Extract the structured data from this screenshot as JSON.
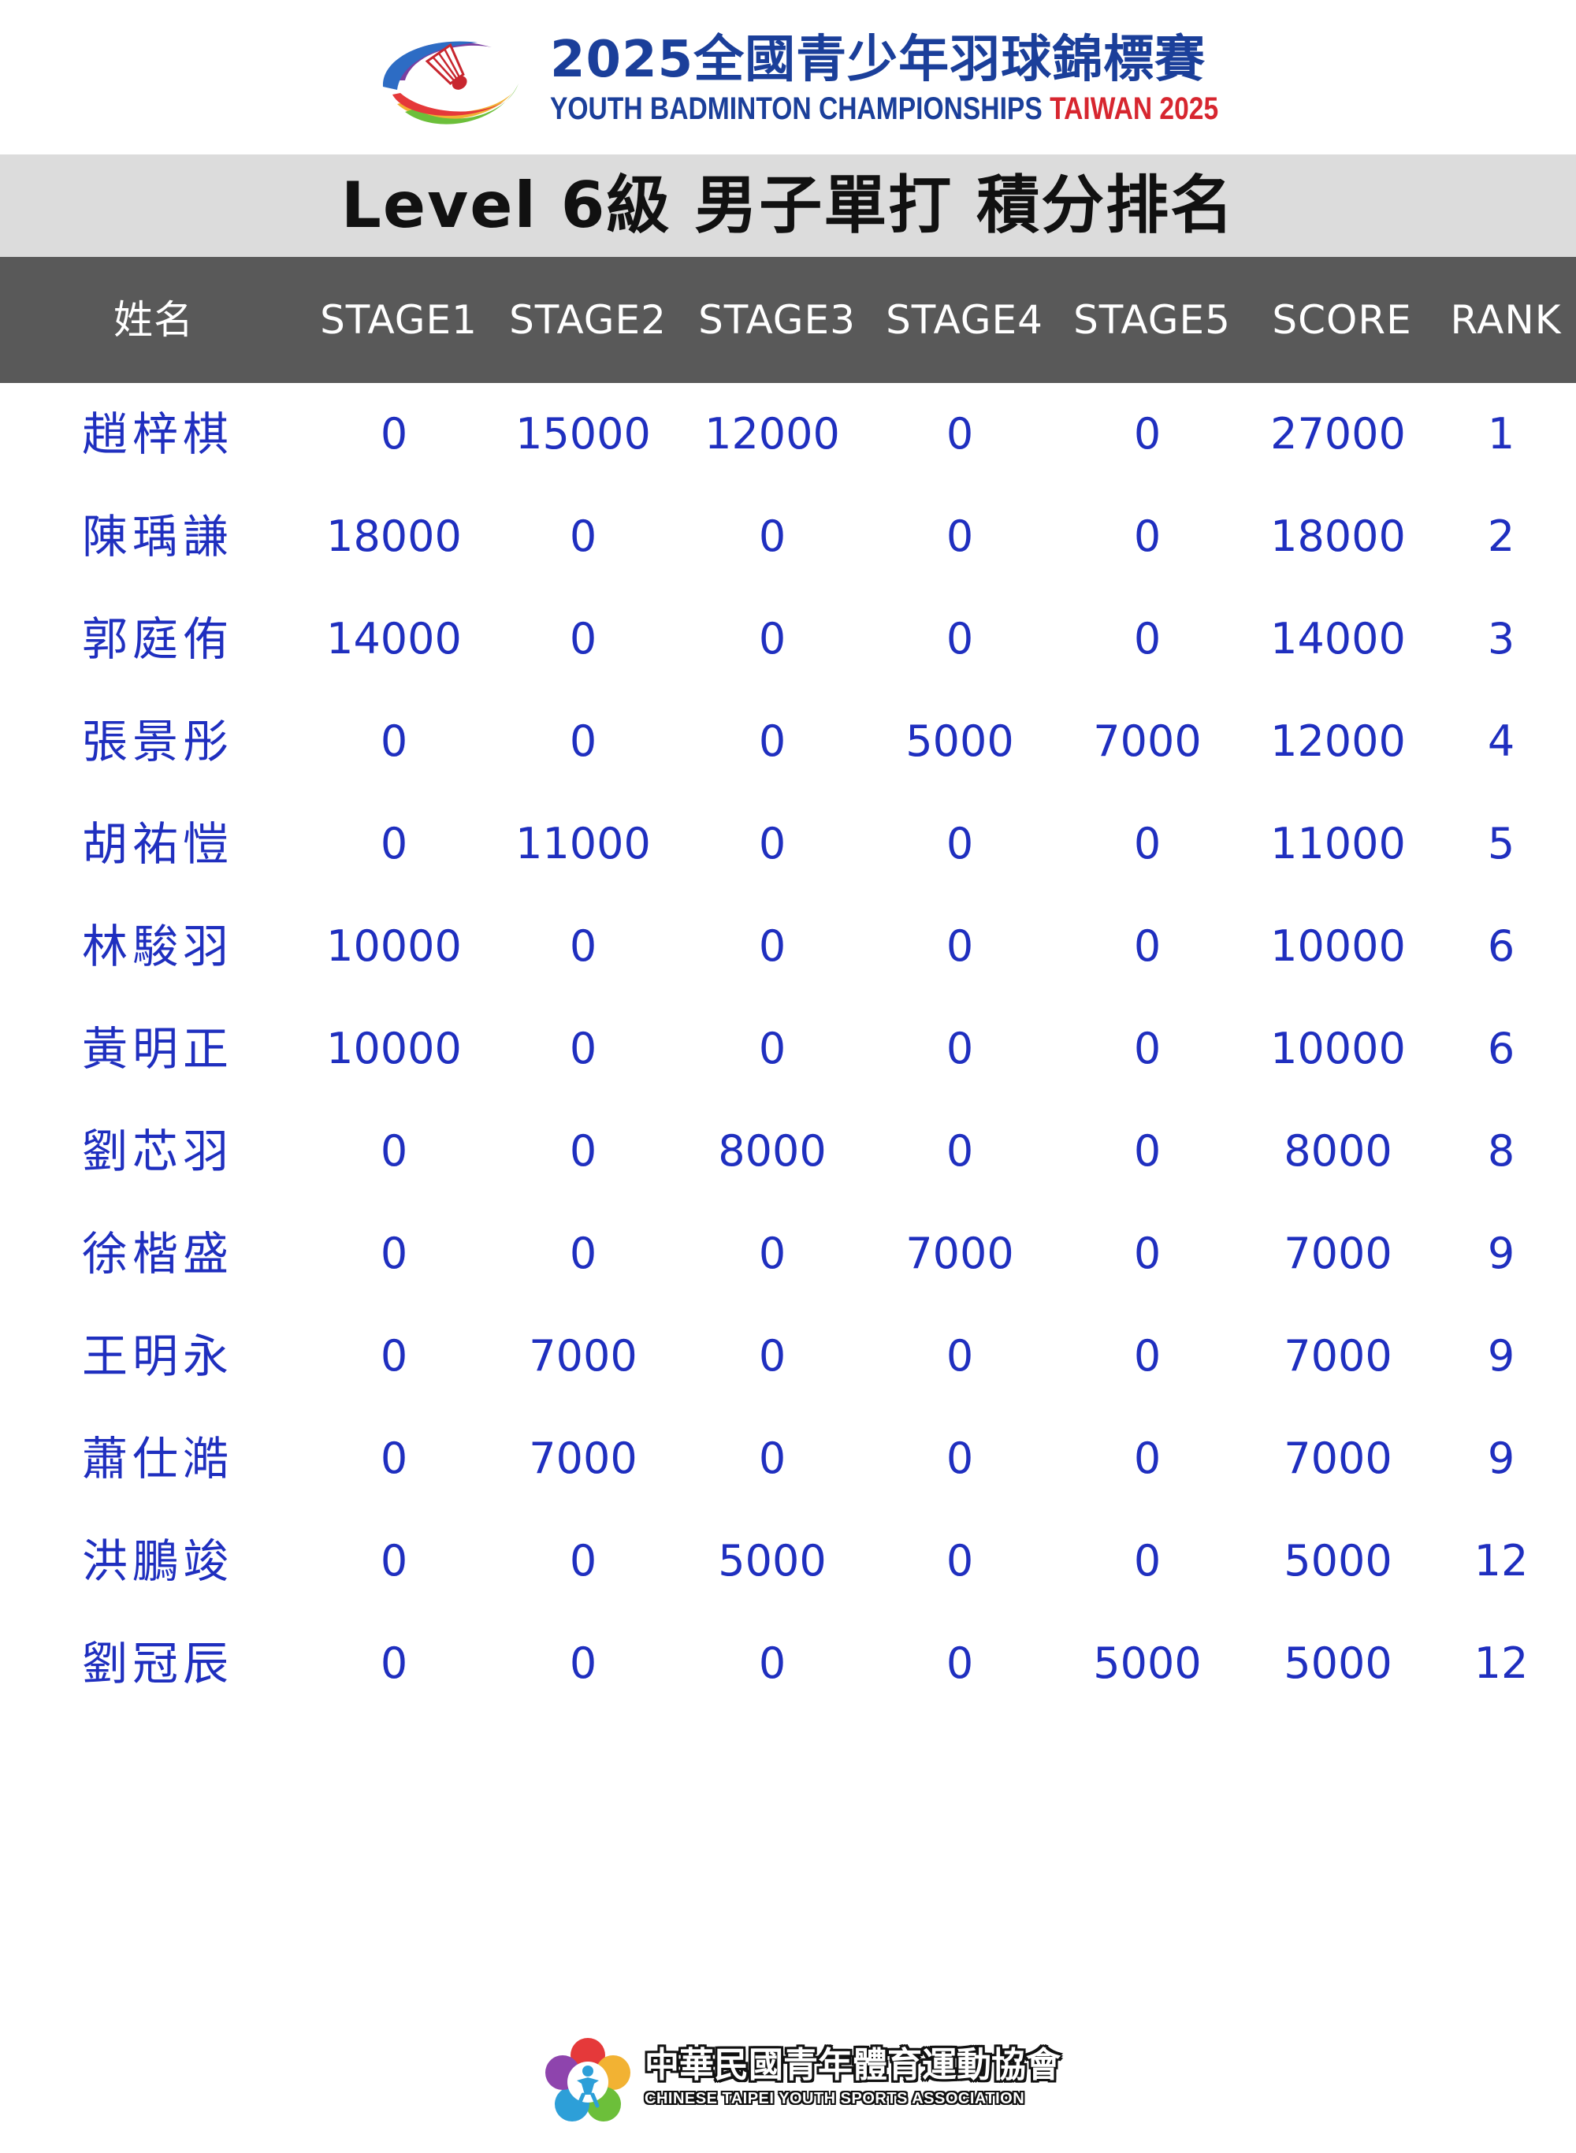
{
  "header": {
    "title_zh": "2025全國青少年羽球錦標賽",
    "title_en_main": "YOUTH BADMINTON CHAMPIONSHIPS",
    "title_en_accent": "TAIWAN 2025"
  },
  "page_title": "Level 6級 男子單打 積分排名",
  "table": {
    "columns": [
      "姓名",
      "STAGE1",
      "STAGE2",
      "STAGE3",
      "STAGE4",
      "STAGE5",
      "SCORE",
      "RANK"
    ],
    "rows": [
      [
        "趙梓棋",
        "0",
        "15000",
        "12000",
        "0",
        "0",
        "27000",
        "1"
      ],
      [
        "陳瑀謙",
        "18000",
        "0",
        "0",
        "0",
        "0",
        "18000",
        "2"
      ],
      [
        "郭庭侑",
        "14000",
        "0",
        "0",
        "0",
        "0",
        "14000",
        "3"
      ],
      [
        "張景彤",
        "0",
        "0",
        "0",
        "5000",
        "7000",
        "12000",
        "4"
      ],
      [
        "胡祐愷",
        "0",
        "11000",
        "0",
        "0",
        "0",
        "11000",
        "5"
      ],
      [
        "林駿羽",
        "10000",
        "0",
        "0",
        "0",
        "0",
        "10000",
        "6"
      ],
      [
        "黃明正",
        "10000",
        "0",
        "0",
        "0",
        "0",
        "10000",
        "6"
      ],
      [
        "劉芯羽",
        "0",
        "0",
        "8000",
        "0",
        "0",
        "8000",
        "8"
      ],
      [
        "徐楷盛",
        "0",
        "0",
        "0",
        "7000",
        "0",
        "7000",
        "9"
      ],
      [
        "王明永",
        "0",
        "7000",
        "0",
        "0",
        "0",
        "7000",
        "9"
      ],
      [
        "蕭仕澔",
        "0",
        "7000",
        "0",
        "0",
        "0",
        "7000",
        "9"
      ],
      [
        "洪鵬竣",
        "0",
        "0",
        "5000",
        "0",
        "0",
        "5000",
        "12"
      ],
      [
        "劉冠辰",
        "0",
        "0",
        "0",
        "0",
        "5000",
        "5000",
        "12"
      ]
    ]
  },
  "footer": {
    "org_zh": "中華民國青年體育運動協會",
    "org_en": "CHINESE TAIPEI YOUTH SPORTS ASSOCIATION"
  },
  "colors": {
    "brand_blue": "#1b3f9a",
    "accent_red": "#d7262f",
    "row_text": "#1f2fbf",
    "header_bar": "#595959",
    "title_band": "#dcdcdc"
  },
  "icons": {
    "event_logo": "shuttlecock-swoosh-logo",
    "footer_logo": "youth-sports-flower-logo"
  }
}
